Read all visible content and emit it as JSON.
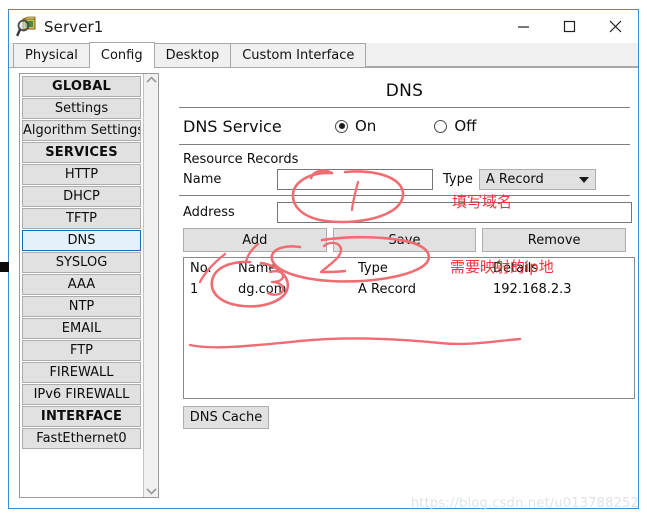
{
  "window": {
    "title": "Server1",
    "icon": "server-magnifier-icon",
    "controls": {
      "minimize": "minimize-icon",
      "maximize": "maximize-icon",
      "close": "close-icon"
    },
    "border_color": "#3a8fd4"
  },
  "tabs": [
    {
      "label": "Physical",
      "active": false
    },
    {
      "label": "Config",
      "active": true
    },
    {
      "label": "Desktop",
      "active": false
    },
    {
      "label": "Custom Interface",
      "active": false
    }
  ],
  "sidebar": {
    "items": [
      {
        "label": "GLOBAL",
        "type": "header"
      },
      {
        "label": "Settings",
        "type": "item"
      },
      {
        "label": "Algorithm Settings",
        "type": "item"
      },
      {
        "label": "SERVICES",
        "type": "header"
      },
      {
        "label": "HTTP",
        "type": "item"
      },
      {
        "label": "DHCP",
        "type": "item"
      },
      {
        "label": "TFTP",
        "type": "item"
      },
      {
        "label": "DNS",
        "type": "item",
        "selected": true
      },
      {
        "label": "SYSLOG",
        "type": "item"
      },
      {
        "label": "AAA",
        "type": "item"
      },
      {
        "label": "NTP",
        "type": "item"
      },
      {
        "label": "EMAIL",
        "type": "item"
      },
      {
        "label": "FTP",
        "type": "item"
      },
      {
        "label": "FIREWALL",
        "type": "item"
      },
      {
        "label": "IPv6 FIREWALL",
        "type": "item"
      },
      {
        "label": "INTERFACE",
        "type": "header"
      },
      {
        "label": "FastEthernet0",
        "type": "item"
      }
    ],
    "scroll_up_icon": "chevron-up-icon",
    "scroll_down_icon": "chevron-down-icon",
    "selected_bg": "#e4f1fb",
    "selected_border": "#1c6cb5"
  },
  "main": {
    "panel_title": "DNS",
    "service": {
      "label": "DNS Service",
      "on_label": "On",
      "off_label": "Off",
      "selected": "On"
    },
    "resource_records_label": "Resource Records",
    "name_field": {
      "label": "Name",
      "value": "",
      "placeholder": ""
    },
    "type_field": {
      "label": "Type",
      "selected": "A Record",
      "arrow_icon": "caret-down-icon"
    },
    "address_field": {
      "label": "Address",
      "value": "",
      "placeholder": ""
    },
    "buttons": {
      "add": "Add",
      "save": "Save",
      "remove": "Remove"
    },
    "table": {
      "columns": [
        "No.",
        "Name",
        "Type",
        "Details"
      ],
      "rows": [
        [
          "1",
          "dg.com",
          "A Record",
          "192.168.2.3"
        ]
      ]
    },
    "cache_button": "DNS Cache"
  },
  "annotations": {
    "note_name": "填写域名",
    "note_address": "需要映射的ip地",
    "marks": [
      "1",
      "2",
      "3"
    ],
    "color": "#f0333c"
  },
  "watermark": "https://blog.csdn.net/u013788252"
}
